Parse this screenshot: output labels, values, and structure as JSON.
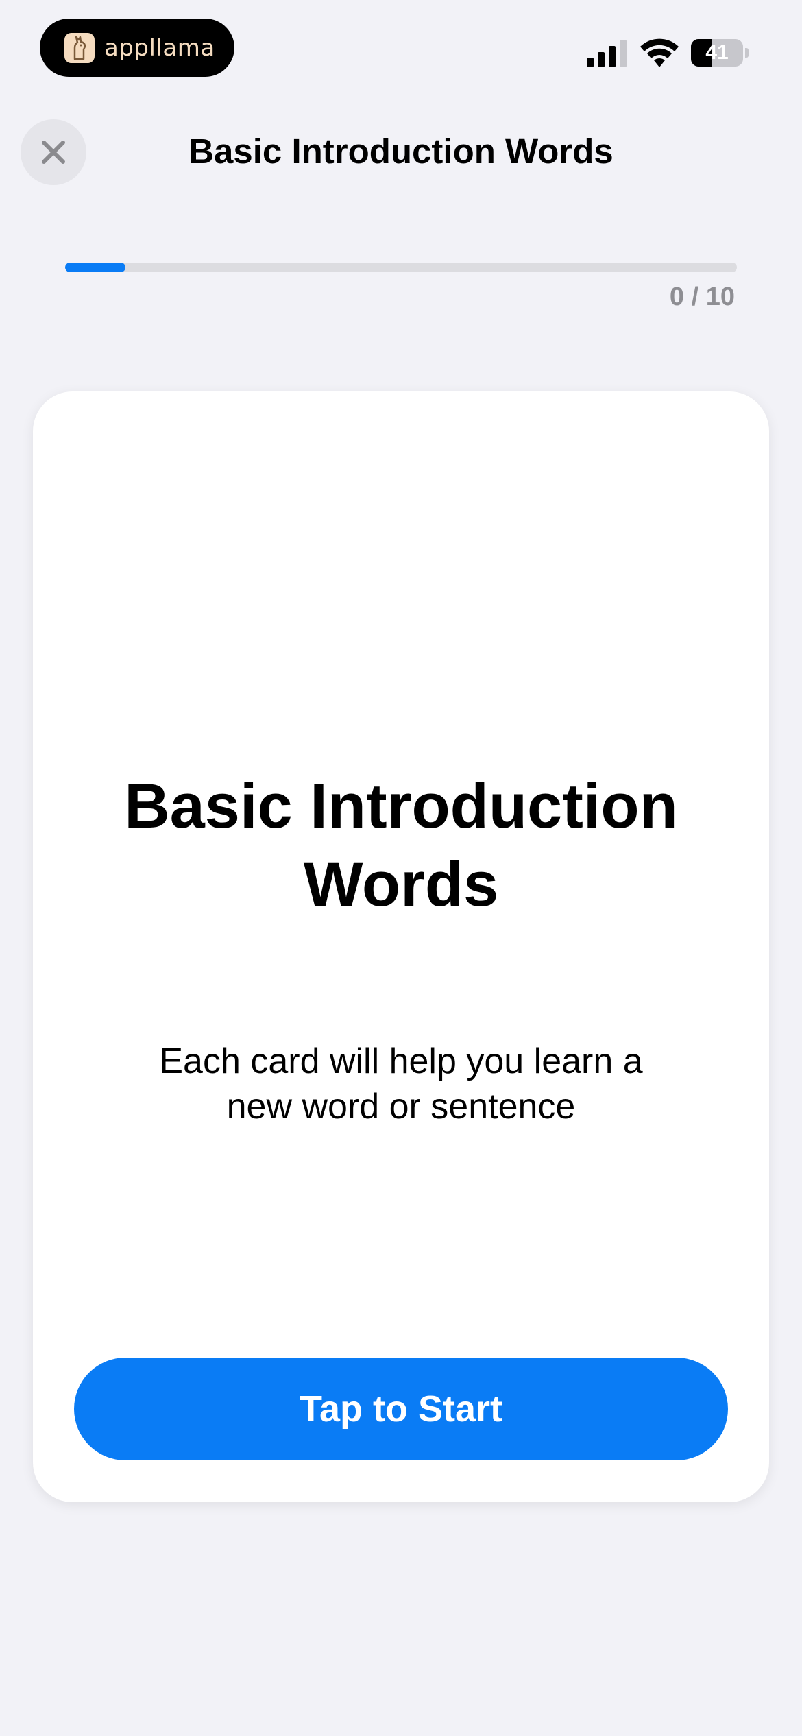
{
  "status_bar": {
    "app_name": "appllama",
    "battery_level": "41",
    "battery_percent": 41,
    "logo_icon": "llama-icon",
    "signal_icon": "cellular-signal-icon",
    "wifi_icon": "wifi-icon"
  },
  "header": {
    "title": "Basic Introduction Words",
    "close_icon": "close-icon"
  },
  "progress": {
    "label": "0 / 10",
    "current": 0,
    "total": 10,
    "fill_fraction": 0.09
  },
  "card": {
    "title": "Basic Introduction Words",
    "subtitle": "Each card will help you learn a new word or sentence",
    "button_label": "Tap to Start"
  },
  "colors": {
    "background": "#f2f2f7",
    "accent": "#0a7cf5",
    "progress_track": "#dcdce0",
    "card": "#ffffff"
  }
}
